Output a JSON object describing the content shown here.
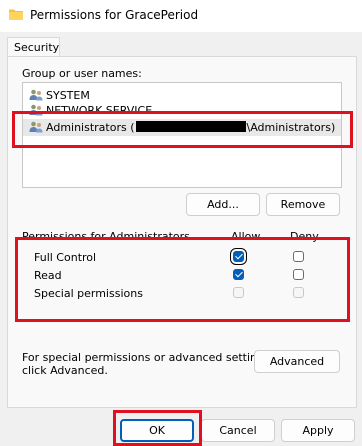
{
  "window": {
    "title": "Permissions for GracePeriod"
  },
  "tabs": [
    {
      "label": "Security"
    }
  ],
  "groups": {
    "label": "Group or user names:",
    "items": [
      {
        "name": "SYSTEM"
      },
      {
        "name": "NETWORK SERVICE"
      },
      {
        "name_prefix": "Administrators (",
        "name_suffix": "\\Administrators)",
        "selected": true
      }
    ]
  },
  "buttons": {
    "add": "Add...",
    "remove": "Remove",
    "advanced": "Advanced",
    "ok": "OK",
    "cancel": "Cancel",
    "apply": "Apply"
  },
  "permissions": {
    "header": "Permissions for Administrators",
    "allow_label": "Allow",
    "deny_label": "Deny",
    "rows": [
      {
        "name": "Full Control",
        "allow": "checked",
        "deny": "unchecked"
      },
      {
        "name": "Read",
        "allow": "checked",
        "deny": "unchecked"
      },
      {
        "name": "Special permissions",
        "allow": "disabled",
        "deny": "disabled"
      }
    ]
  },
  "advanced_note": {
    "line1": "For special permissions or advanced settings,",
    "line2": "click Advanced."
  },
  "colors": {
    "accent": "#005fb8",
    "highlight": "#e01020"
  }
}
